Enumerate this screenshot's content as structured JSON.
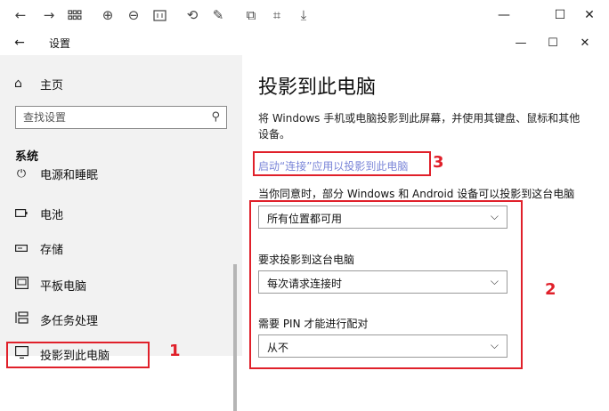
{
  "window": {
    "title": "设置",
    "back_icon": "arrow-left-icon"
  },
  "outer_toolbar": {
    "icons": [
      "arrow-left-icon",
      "arrow-right-icon",
      "grid-icon",
      "zoom-in-icon",
      "zoom-out-icon",
      "fit-icon",
      "rotate-icon",
      "edit-icon",
      "copy-icon",
      "crop-icon",
      "download-icon"
    ]
  },
  "sidebar": {
    "home": {
      "label": "主页",
      "icon": "home-icon"
    },
    "search": {
      "placeholder": "查找设置",
      "icon": "search-icon"
    },
    "section": "系统",
    "items": [
      {
        "label": "电源和睡眠",
        "icon": "power-icon"
      },
      {
        "label": "电池",
        "icon": "battery-icon"
      },
      {
        "label": "存储",
        "icon": "storage-icon"
      },
      {
        "label": "平板电脑",
        "icon": "tablet-icon"
      },
      {
        "label": "多任务处理",
        "icon": "multitask-icon"
      },
      {
        "label": "投影到此电脑",
        "icon": "project-icon"
      }
    ]
  },
  "main": {
    "title": "投影到此电脑",
    "description": "将 Windows 手机或电脑投影到此屏幕，并使用其键盘、鼠标和其他设备。",
    "launch_link": "启动“连接”应用以投影到此电脑",
    "options": [
      {
        "label": "当你同意时，部分 Windows 和 Android 设备可以投影到这台电脑",
        "value": "所有位置都可用"
      },
      {
        "label": "要求投影到这台电脑",
        "value": "每次请求连接时"
      },
      {
        "label": "需要 PIN 才能进行配对",
        "value": "从不"
      }
    ]
  },
  "annotations": {
    "one": "1",
    "two": "2",
    "three": "3"
  },
  "colors": {
    "annotation": "#e0202a",
    "link": "#7a85d8",
    "sidebar_bg": "#f2f2f2"
  }
}
